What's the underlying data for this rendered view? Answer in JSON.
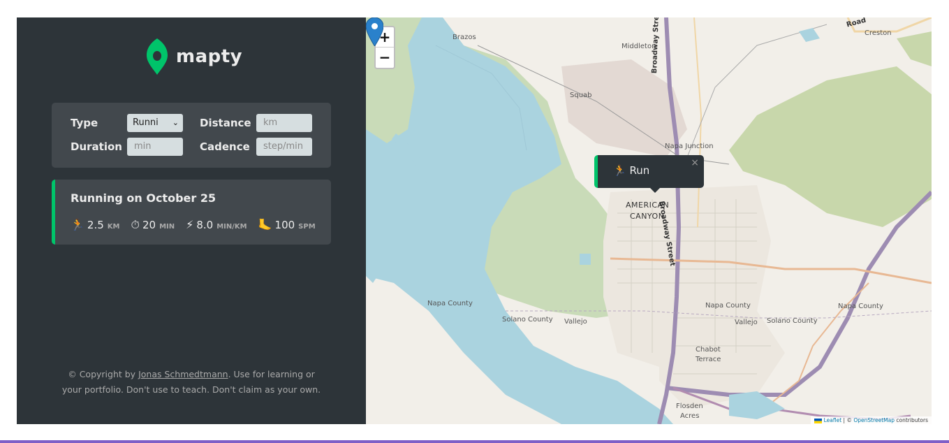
{
  "app": {
    "name": "mapty",
    "brand_color": "#00c46a",
    "sidebar_color": "#2d3439",
    "panel_color": "#42484d"
  },
  "form": {
    "type_label": "Type",
    "type_value": "Runni",
    "distance_label": "Distance",
    "distance_placeholder": "km",
    "duration_label": "Duration",
    "duration_placeholder": "min",
    "cadence_label": "Cadence",
    "cadence_placeholder": "step/min"
  },
  "workouts": [
    {
      "title": "Running on October 25",
      "details": [
        {
          "icon": "running-icon",
          "glyph": "🏃",
          "value": "2.5",
          "unit": "km"
        },
        {
          "icon": "stopwatch-icon",
          "glyph": "⏱",
          "value": "20",
          "unit": "min"
        },
        {
          "icon": "lightning-icon",
          "glyph": "⚡",
          "value": "8.0",
          "unit": "min/km"
        },
        {
          "icon": "footprint-icon",
          "glyph": "🦶",
          "value": "100",
          "unit": "spm"
        }
      ]
    }
  ],
  "copyright": {
    "prefix": "© Copyright by ",
    "author": "Jonas Schmedtmann",
    "suffix": ". Use for learning or your portfolio. Don't use to teach. Don't claim as your own."
  },
  "map": {
    "zoom_in": "+",
    "zoom_out": "−",
    "popup_text": "🏃 Run",
    "popup_close": "×",
    "labels": {
      "brazos": "Brazos",
      "middleton": "Middleton",
      "creston": "Creston",
      "squab": "Squab",
      "broadway_1": "Broadway Street",
      "broadway_2": "Broadway Street",
      "napa_junction": "Napa Junction",
      "american": "AMERICAN",
      "canyon": "CANYON",
      "napa_county_1": "Napa County",
      "napa_county_2": "Napa County",
      "napa_county_3": "Napa County",
      "solano_county_1": "Solano County",
      "solano_county_2": "Solano County",
      "vallejo_1": "Vallejo",
      "vallejo_2": "Vallejo",
      "chabot": "Chabot",
      "terrace": "Terrace",
      "flosden": "Flosden",
      "acres": "Acres",
      "road": "Road"
    },
    "attribution": {
      "leaflet": "Leaflet",
      "sep": " | © ",
      "osm": "OpenStreetMap",
      "rest": " contributors"
    },
    "colors": {
      "water": "#aad3df",
      "park": "#c8d7ab",
      "marker": "#2a81cb"
    }
  }
}
